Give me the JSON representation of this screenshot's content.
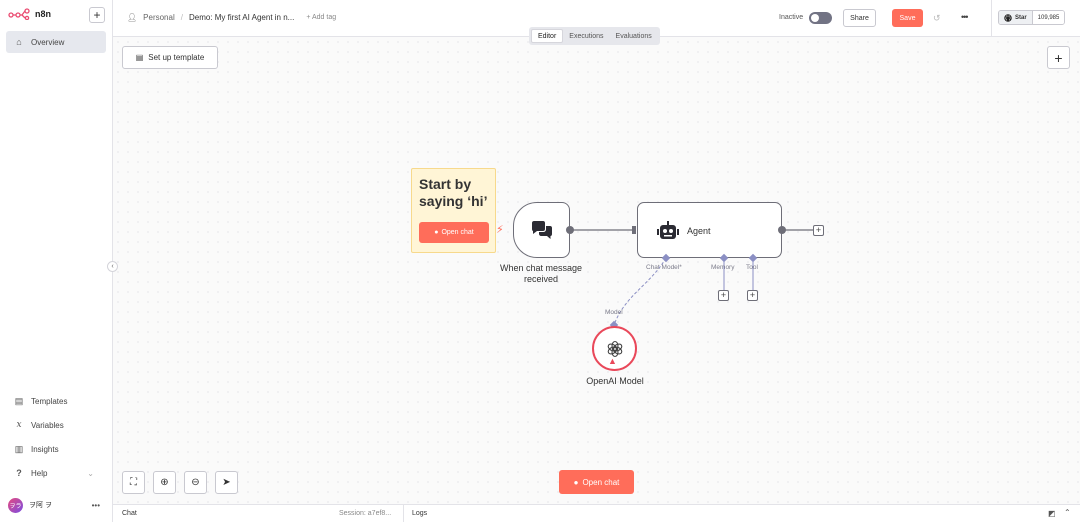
{
  "app": {
    "name": "n8n",
    "new_label": "+"
  },
  "sidebar": {
    "top_items": [
      {
        "label": "Overview",
        "icon": "home-icon",
        "active": true
      }
    ],
    "bottom_items": [
      {
        "label": "Templates",
        "icon": "templates-icon"
      },
      {
        "label": "Variables",
        "icon": "variables-icon"
      },
      {
        "label": "Insights",
        "icon": "insights-icon"
      },
      {
        "label": "Help",
        "icon": "help-icon"
      }
    ],
    "user": {
      "initials": "ヲラ",
      "name": "ヲ阿 ヲ",
      "more": "•••"
    },
    "collapse": "‹"
  },
  "header": {
    "project": "Personal",
    "separator": "/",
    "workflow_name": "Demo: My first AI Agent in n...",
    "add_tag": "+ Add tag",
    "status_label": "Inactive",
    "share": "Share",
    "save": "Save",
    "more": "•••",
    "github": {
      "star": "Star",
      "count": "109,985"
    }
  },
  "tabs": [
    {
      "label": "Editor",
      "active": true
    },
    {
      "label": "Executions"
    },
    {
      "label": "Evaluations"
    }
  ],
  "canvas": {
    "setup_template": "Set up template",
    "add_node": "+",
    "sticky": {
      "title": "Start by saying ‘hi’",
      "button": "Open chat"
    },
    "nodes": {
      "trigger": {
        "label": "When chat message received"
      },
      "agent": {
        "label": "Agent",
        "ports": {
          "chat_model": "Chat Model*",
          "memory": "Memory",
          "tool": "Tool"
        }
      },
      "openai": {
        "label": "OpenAI Model",
        "port": "Model"
      }
    },
    "open_chat": "Open chat"
  },
  "bottom_bar": {
    "chat": "Chat",
    "session": "Session: a7ef8...",
    "logs": "Logs"
  },
  "colors": {
    "accent": "#ff6d5a",
    "error": "#e9485a",
    "sticky": "#fff5d6",
    "port": "#8b8fc4"
  }
}
